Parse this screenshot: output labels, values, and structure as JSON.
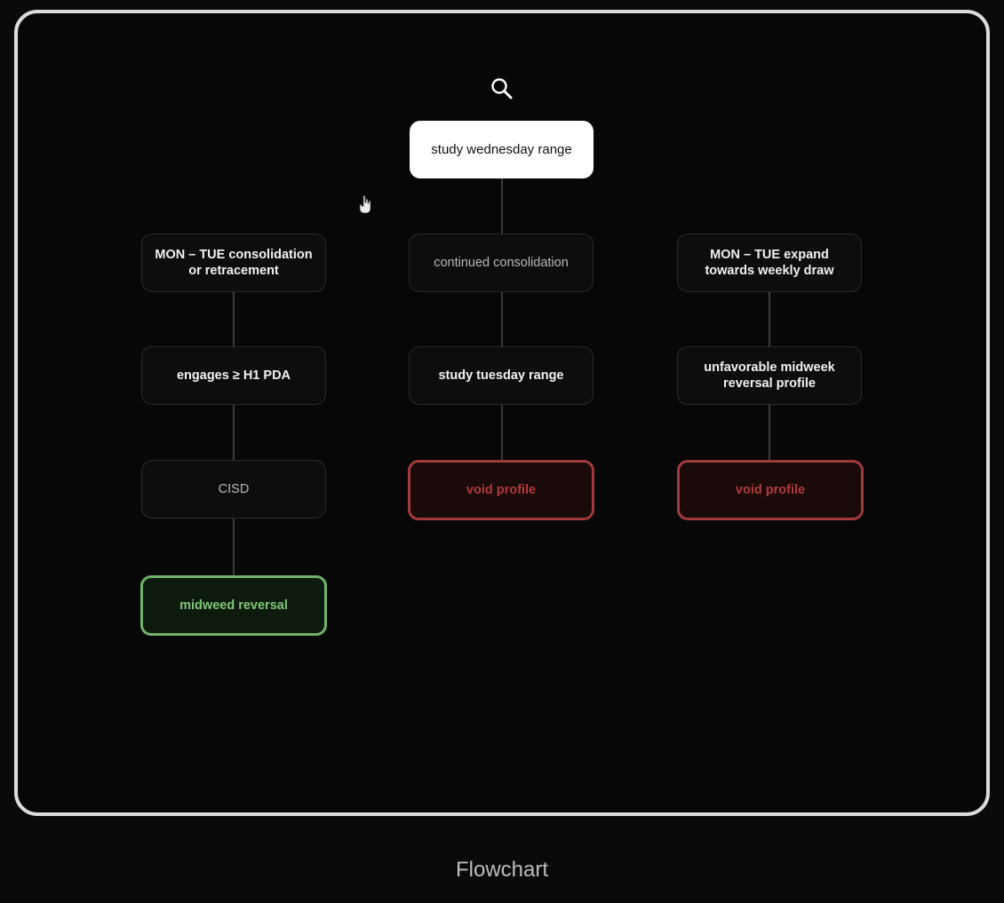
{
  "diagram": {
    "root": {
      "label": "study wednesday range"
    },
    "columns": [
      {
        "nodes": [
          {
            "label": "MON – TUE consolidation or retracement",
            "kind": "normal"
          },
          {
            "label": "engages ≥ H1 PDA",
            "kind": "normal"
          },
          {
            "label": "CISD",
            "kind": "muted"
          },
          {
            "label": "midweed reversal",
            "kind": "success"
          }
        ]
      },
      {
        "nodes": [
          {
            "label": "continued consolidation",
            "kind": "muted"
          },
          {
            "label": "study tuesday range",
            "kind": "normal"
          },
          {
            "label": "void profile",
            "kind": "void"
          }
        ]
      },
      {
        "nodes": [
          {
            "label": "MON – TUE expand towards weekly draw",
            "kind": "normal"
          },
          {
            "label": "unfavorable midweek reversal profile",
            "kind": "normal"
          },
          {
            "label": "void profile",
            "kind": "void"
          }
        ]
      }
    ]
  },
  "icons": {
    "search": "search-icon",
    "cursor": "hand-cursor-icon"
  },
  "colors": {
    "background": "#0a0a0a",
    "frame_border": "#dcdcdc",
    "void": "#a23a3a",
    "success": "#6fb46a",
    "root_fill": "#ffffff"
  },
  "caption": "Flowchart"
}
